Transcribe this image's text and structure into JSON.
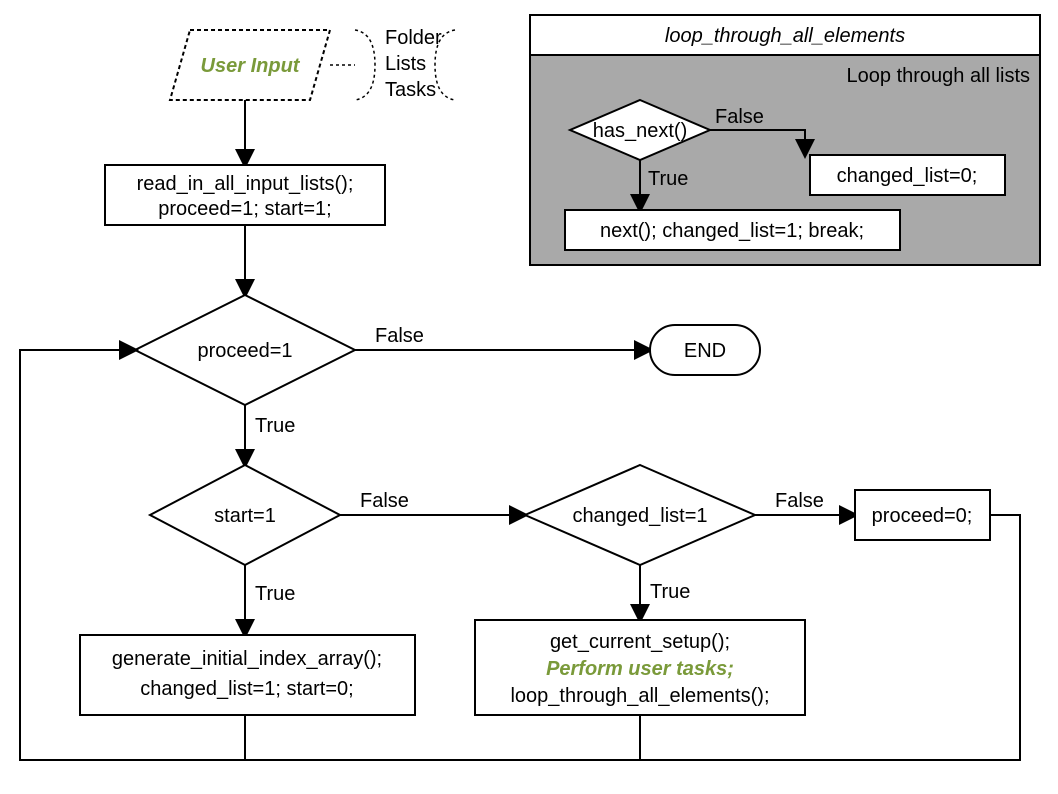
{
  "main": {
    "userInput": "User Input",
    "annotation": {
      "l1": "Folder",
      "l2": "Lists",
      "l3": "Tasks"
    },
    "init": {
      "l1": "read_in_all_input_lists();",
      "l2": "proceed=1; start=1;"
    },
    "proceed": {
      "cond": "proceed=1",
      "t": "True",
      "f": "False"
    },
    "end": "END",
    "start": {
      "cond": "start=1",
      "t": "True",
      "f": "False"
    },
    "changed": {
      "cond": "changed_list=1",
      "t": "True",
      "f": "False"
    },
    "proceedZero": "proceed=0;",
    "genInit": {
      "l1": "generate_initial_index_array();",
      "l2": "changed_list=1; start=0;"
    },
    "perform": {
      "l1": "get_current_setup();",
      "l2": "Perform user tasks;",
      "l3": "loop_through_all_elements();"
    }
  },
  "sub": {
    "title": "loop_through_all_elements",
    "caption": "Loop through all lists",
    "hasNext": {
      "cond": "has_next()",
      "t": "True",
      "f": "False"
    },
    "changedZero": "changed_list=0;",
    "nextStmt": "next(); changed_list=1; break;"
  }
}
